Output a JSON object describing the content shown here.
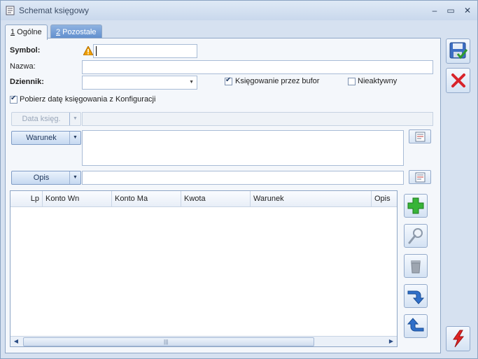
{
  "window": {
    "title": "Schemat księgowy",
    "controls": {
      "minimize": "–",
      "maximize": "▭",
      "close": "✕"
    }
  },
  "tabs": [
    {
      "hotkey": "1",
      "label": " Ogólne",
      "active": true
    },
    {
      "hotkey": "2",
      "label": " Pozostałe",
      "active": false
    }
  ],
  "form": {
    "symbol_label": "Symbol:",
    "symbol_value": "",
    "nazwa_label": "Nazwa:",
    "nazwa_value": "",
    "dziennik_label": "Dziennik:",
    "dziennik_value": "",
    "ksiegowanie_bufor_label": "Księgowanie przez bufor",
    "ksiegowanie_bufor_checked": true,
    "nieaktywny_label": "Nieaktywny",
    "nieaktywny_checked": false,
    "pobierz_date_label": "Pobierz datę księgowania z Konfiguracji",
    "pobierz_date_checked": true,
    "data_ksieg_label": "Data księg.",
    "warunek_label": "Warunek",
    "opis_label": "Opis"
  },
  "grid": {
    "columns": [
      "Lp",
      "Konto Wn",
      "Konto Ma",
      "Kwota",
      "Warunek",
      "Opis"
    ],
    "rows": [],
    "scroll_grip": "|||"
  },
  "icons": {
    "warning": "warning-icon",
    "save": "save-icon",
    "cancel": "cancel-icon",
    "add": "add-icon",
    "edit": "magnifier-icon",
    "delete": "trash-icon",
    "down": "arrow-down-icon",
    "up": "arrow-up-icon",
    "lightning": "lightning-icon",
    "expression": "expression-builder-icon"
  },
  "colors": {
    "accent": "#5d8ccc",
    "save_green": "#2e9b2e",
    "cancel_red": "#d8232a",
    "warning": "#f0a000"
  }
}
